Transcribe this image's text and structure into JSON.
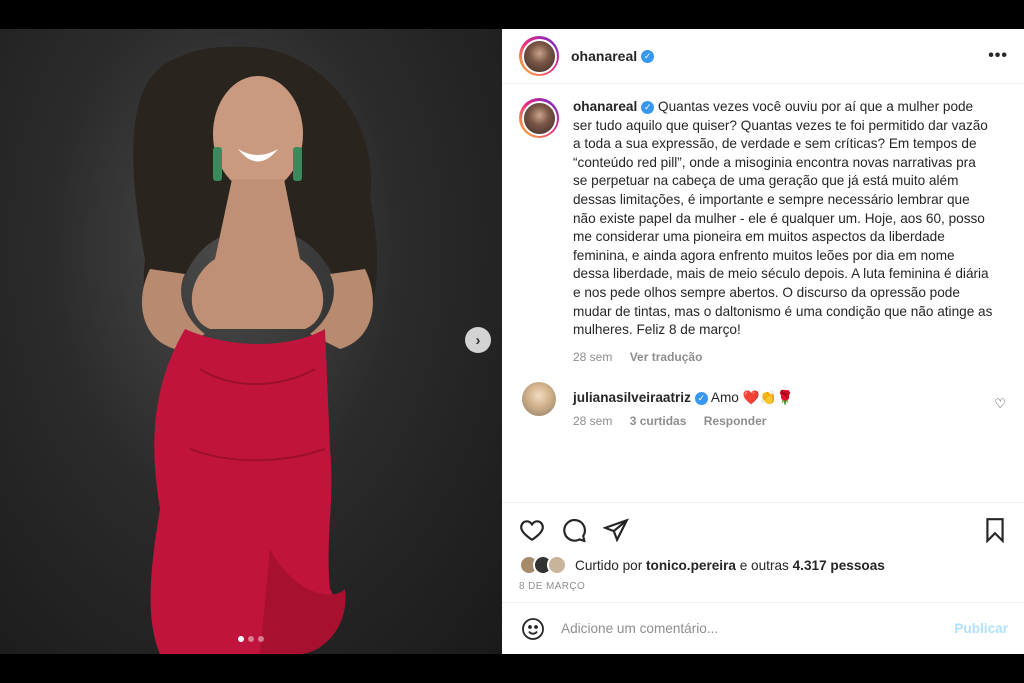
{
  "post": {
    "username": "ohanareal",
    "verified_icon": "verified-badge-icon",
    "more_icon": "more-options-icon"
  },
  "media": {
    "next_icon": "chevron-right-icon",
    "next_glyph": "›",
    "slides_count": 3,
    "active_slide": 1
  },
  "caption": {
    "username": "ohanareal",
    "text": "Quantas vezes você ouviu por aí que a mulher pode ser tudo aquilo que quiser? Quantas vezes te foi permitido dar vazão a toda a sua expressão, de verdade e sem críticas? Em tempos de “conteúdo red pill”, onde a misoginia encontra novas narrativas pra se perpetuar na cabeça de uma geração que já está muito além dessas limitações, é importante e sempre necessário lembrar que não existe papel da mulher - ele é qualquer um. Hoje, aos 60, posso me considerar uma pioneira em muitos aspectos da liberdade feminina, e ainda agora enfrento muitos leões por dia em nome dessa liberdade, mais de meio século depois. A luta feminina é diária e nos pede olhos sempre abertos. O discurso da opressão pode mudar de tintas, mas o daltonismo é uma condição que não atinge as mulheres. Feliz 8 de março!",
    "time": "28 sem",
    "translate": "Ver tradução"
  },
  "comment": {
    "username": "julianasilveiraatriz",
    "text": "Amo ❤️👏🌹",
    "time": "28 sem",
    "likes": "3 curtidas",
    "reply": "Responder",
    "like_icon": "heart-outline-icon"
  },
  "actions": {
    "like_icon": "heart-outline-icon",
    "comment_icon": "comment-bubble-icon",
    "share_icon": "paper-plane-icon",
    "save_icon": "bookmark-icon"
  },
  "likes": {
    "prefix": "Curtido por",
    "user": "tonico.pereira",
    "middle": "e outras",
    "count": "4.317 pessoas"
  },
  "date": "8 DE MARÇO",
  "add_comment": {
    "emoji_icon": "smiley-icon",
    "placeholder": "Adicione um comentário...",
    "publish": "Publicar"
  },
  "colors": {
    "accent": "#3897f0",
    "publish_disabled": "#b2dffc",
    "dress": "#c0143c"
  }
}
